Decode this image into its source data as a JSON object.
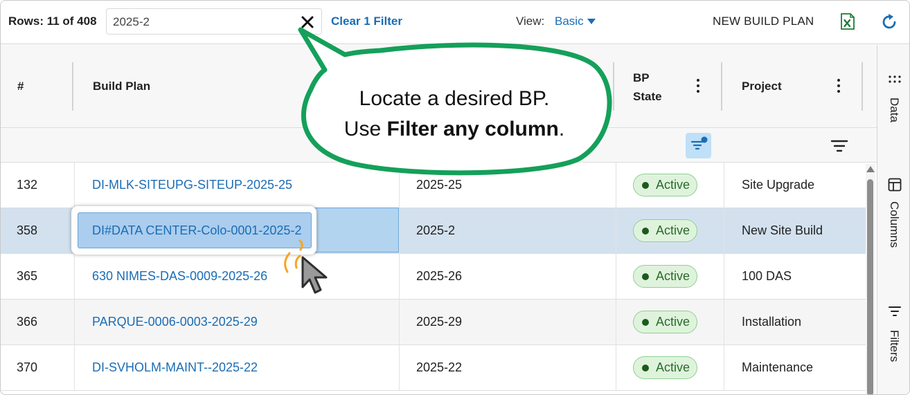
{
  "toolbar": {
    "rows_label": "Rows: 11 of 408",
    "search_value": "2025-2",
    "clear_filter_label": "Clear 1 Filter",
    "view_label": "View:",
    "view_value": "Basic",
    "new_build_plan_label": "NEW BUILD PLAN"
  },
  "columns": {
    "num": "#",
    "build_plan": "Build Plan",
    "bp_state_line1": "BP",
    "bp_state_line2": "State",
    "project": "Project"
  },
  "rows": [
    {
      "num": "132",
      "build_plan": "DI-MLK-SITEUPG-SITEUP-2025-25",
      "year": "2025-25",
      "state": "Active",
      "project": "Site Upgrade"
    },
    {
      "num": "358",
      "build_plan": "DI#DATA CENTER-Colo-0001-2025-2",
      "year": "2025-2",
      "state": "Active",
      "project": "New Site Build"
    },
    {
      "num": "365",
      "build_plan": "630 NIMES-DAS-0009-2025-26",
      "year": "2025-26",
      "state": "Active",
      "project": "100 DAS"
    },
    {
      "num": "366",
      "build_plan": "PARQUE-0006-0003-2025-29",
      "year": "2025-29",
      "state": "Active",
      "project": "Installation"
    },
    {
      "num": "370",
      "build_plan": "DI-SVHOLM-MAINT--2025-22",
      "year": "2025-22",
      "state": "Active",
      "project": "Maintenance"
    }
  ],
  "side_panel": {
    "data": "Data",
    "columns": "Columns",
    "filters": "Filters"
  },
  "callout": {
    "line1": "Locate a desired BP.",
    "line2_prefix": "Use ",
    "line2_bold": "Filter any column",
    "line2_suffix": "."
  },
  "colors": {
    "link": "#1a6db5",
    "selected_row": "#d3e1ee",
    "badge_bg": "#dff3dc",
    "callout_border": "#14a05a",
    "cursor_accent": "#f5a623"
  }
}
